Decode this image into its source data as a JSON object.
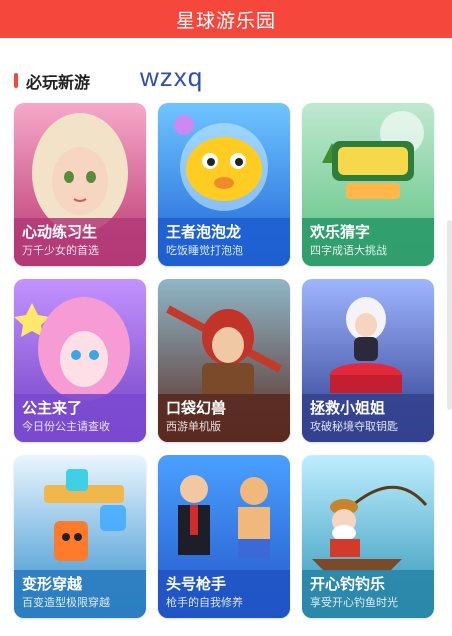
{
  "header": {
    "title": "星球游乐园"
  },
  "section": {
    "title": "必玩新游"
  },
  "overlay_text": "wzxq",
  "games": [
    {
      "name": "心动练习生",
      "desc": "万千少女的首选",
      "icon": "anime-girl-portrait",
      "color": "#c24a8a"
    },
    {
      "name": "王者泡泡龙",
      "desc": "吃饭睡觉打泡泡",
      "icon": "puffer-fish-bubble",
      "color": "#2a7fdc"
    },
    {
      "name": "欢乐猜字",
      "desc": "四字成语大挑战",
      "icon": "word-guess-logo",
      "color": "#2d9f6b"
    },
    {
      "name": "公主来了",
      "desc": "今日份公主请查收",
      "icon": "princess-portrait",
      "color": "#8a5ad4"
    },
    {
      "name": "口袋幻兽",
      "desc": "西游单机版",
      "icon": "warrior-hero",
      "color": "#6e3a2a"
    },
    {
      "name": "拯救小姐姐",
      "desc": "攻破秘境夺取钥匙",
      "icon": "girl-on-pedestal",
      "color": "#3c4a9a"
    },
    {
      "name": "变形穿越",
      "desc": "百变造型极限穿越",
      "icon": "jelly-cube",
      "color": "#2f8ccc"
    },
    {
      "name": "头号枪手",
      "desc": "枪手的自我修养",
      "icon": "pixel-gunmen",
      "color": "#2e6ad8"
    },
    {
      "name": "开心钓钓乐",
      "desc": "享受开心钓鱼时光",
      "icon": "fisherman-boat",
      "color": "#2a93b5"
    }
  ]
}
